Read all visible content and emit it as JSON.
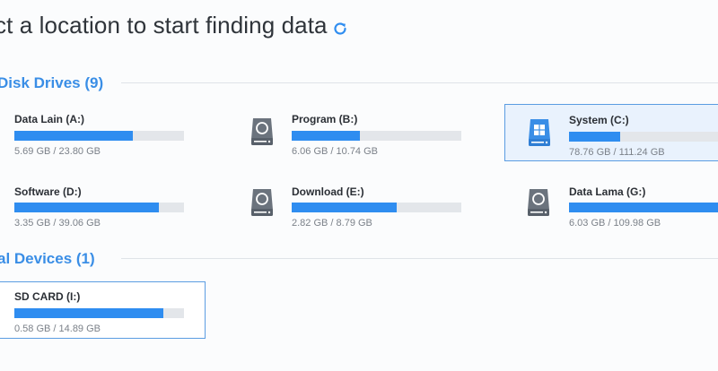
{
  "header": {
    "title": "ct a location to start finding data"
  },
  "sections": {
    "disk_drives": {
      "label": "Disk Drives (9)"
    },
    "external_devices": {
      "label": "al Devices (1)"
    }
  },
  "drives": [
    {
      "name": "Data Lain (A:)",
      "size": "5.69 GB / 23.80 GB",
      "used_fraction": 0.7,
      "icon": "none"
    },
    {
      "name": "Program (B:)",
      "size": "6.06 GB / 10.74 GB",
      "used_fraction": 0.4,
      "icon": "hard-drive-icon"
    },
    {
      "name": "System (C:)",
      "size": "78.76 GB / 111.24 GB",
      "used_fraction": 0.3,
      "icon": "windows-drive-icon",
      "selected": true
    },
    {
      "name": "Software (D:)",
      "size": "3.35 GB / 39.06 GB",
      "used_fraction": 0.85,
      "icon": "none"
    },
    {
      "name": "Download (E:)",
      "size": "2.82 GB / 8.79 GB",
      "used_fraction": 0.62,
      "icon": "hard-drive-icon"
    },
    {
      "name": "Data Lama (G:)",
      "size": "6.03 GB / 109.98 GB",
      "used_fraction": 0.95,
      "icon": "hard-drive-icon"
    },
    {
      "name": "SD CARD (I:)",
      "size": "0.58 GB / 14.89 GB",
      "used_fraction": 0.88,
      "icon": "none"
    }
  ],
  "colors": {
    "accent": "#3a8ee6",
    "bar_fill": "#2f8df0",
    "bar_track": "#e3e6ea",
    "selected_bg": "#e9f2fd",
    "selected_border": "#5b9de2"
  }
}
